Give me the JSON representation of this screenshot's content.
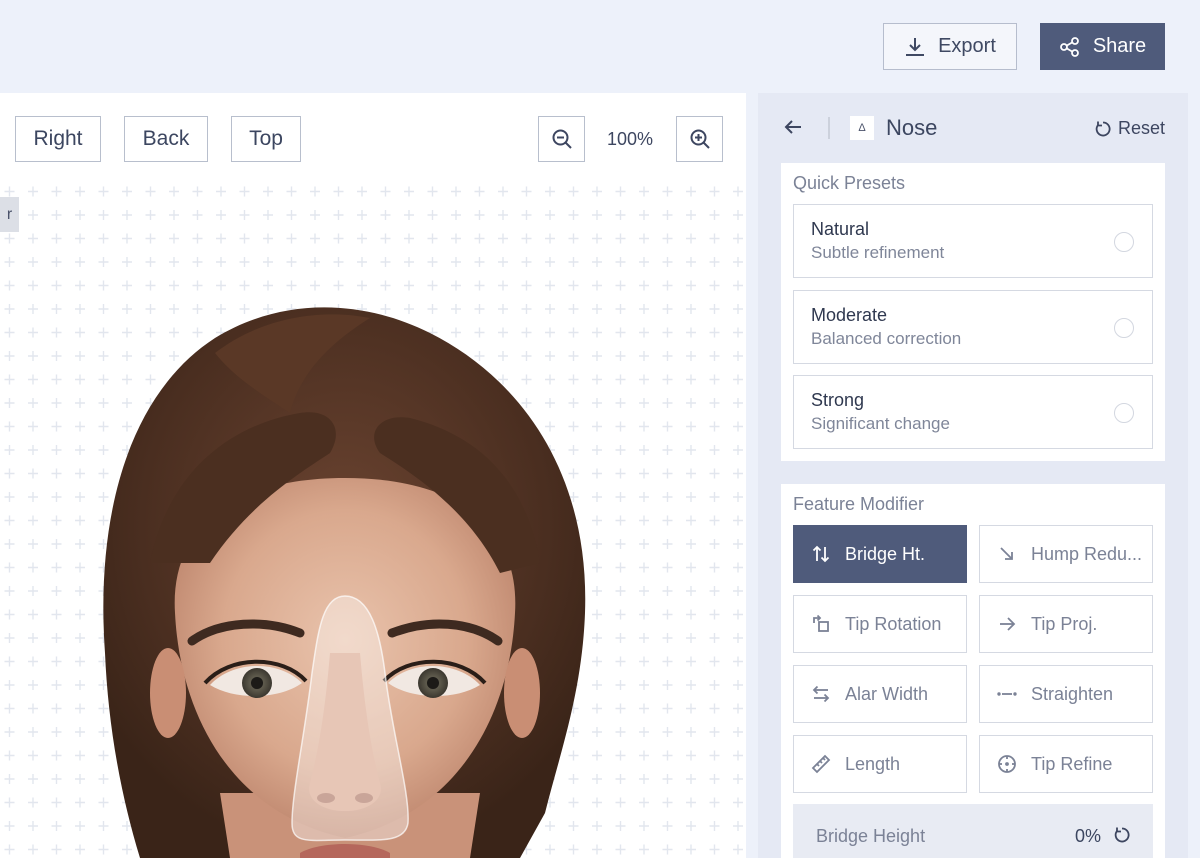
{
  "toolbar": {
    "export_label": "Export",
    "share_label": "Share"
  },
  "viewer": {
    "views": [
      "Right",
      "Back",
      "Top"
    ],
    "zoom": "100%",
    "edge_tab": "r"
  },
  "panel": {
    "title": "Nose",
    "title_icon": "Δ",
    "reset_label": "Reset",
    "quick_presets": {
      "title": "Quick Presets",
      "items": [
        {
          "name": "Natural",
          "desc": "Subtle refinement"
        },
        {
          "name": "Moderate",
          "desc": "Balanced correction"
        },
        {
          "name": "Strong",
          "desc": "Significant change"
        }
      ]
    },
    "feature_modifier": {
      "title": "Feature Modifier",
      "items": [
        {
          "label": "Bridge Ht.",
          "icon": "vertical-arrows-icon",
          "active": true
        },
        {
          "label": "Hump Redu...",
          "icon": "diagonal-arrow-icon",
          "active": false
        },
        {
          "label": "Tip Rotation",
          "icon": "rotate-square-icon",
          "active": false
        },
        {
          "label": "Tip Proj.",
          "icon": "arrow-right-icon",
          "active": false
        },
        {
          "label": "Alar Width",
          "icon": "horizontal-arrows-icon",
          "active": false
        },
        {
          "label": "Straighten",
          "icon": "straighten-icon",
          "active": false
        },
        {
          "label": "Length",
          "icon": "ruler-icon",
          "active": false
        },
        {
          "label": "Tip Refine",
          "icon": "crosshair-icon",
          "active": false
        }
      ]
    },
    "slider": {
      "label": "Bridge Height",
      "value": "0%"
    }
  },
  "colors": {
    "accent": "#4f5b7b",
    "background": "#edf1fa",
    "panel": "#e5e9f4"
  }
}
